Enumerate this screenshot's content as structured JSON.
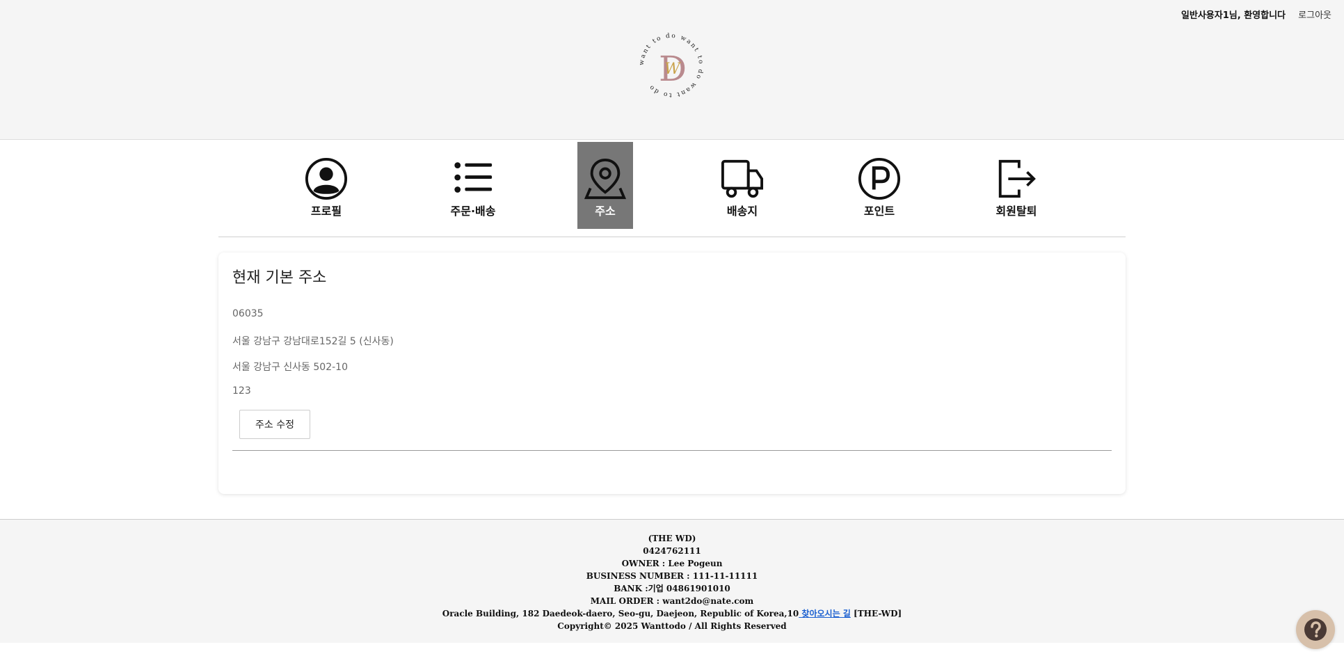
{
  "header": {
    "welcome": "일반사용자1님, 환영합니다",
    "logout": "로그아웃",
    "logo_ring_text": "want to do want to do want to do",
    "logo_letters": "DW",
    "colors": {
      "logo_d": "#b98a8e",
      "logo_w": "#c9a24a"
    }
  },
  "nav": {
    "items": [
      {
        "label": "프로필",
        "icon": "profile-icon"
      },
      {
        "label": "주문·배송",
        "icon": "list-icon"
      },
      {
        "label": "주소",
        "icon": "location-pin-icon",
        "active": true
      },
      {
        "label": "배송지",
        "icon": "truck-icon"
      },
      {
        "label": "포인트",
        "icon": "point-icon"
      },
      {
        "label": "회원탈퇴",
        "icon": "exit-icon"
      }
    ],
    "active_color": "#777777"
  },
  "address": {
    "title": "현재 기본 주소",
    "zipcode": "06035",
    "road": "서울 강남구 강남대로152길 5 (신사동)",
    "jibun": "서울 강남구 신사동 502-10",
    "detail": "123",
    "edit_button": "주소 수정"
  },
  "footer": {
    "company": "(THE WD)",
    "phone": "0424762111",
    "owner": "OWNER : Lee Pogeun",
    "business": "BUSINESS NUMBER : 111-11-11111",
    "bank": "BANK :기업 04861901010",
    "mail": "MAIL ORDER : want2do@nate.com",
    "address": "Oracle Building, 182 Daedeok-daero, Seo-gu, Daejeon, Republic of Korea,10",
    "directions_link": " 찾아오시는 길",
    "address_suffix": " [THE-WD]",
    "copyright": "Copyright© 2025 Wanttodo / All Rights Reserved"
  },
  "help": {
    "icon": "question-icon",
    "color": "#d7c0aa"
  }
}
